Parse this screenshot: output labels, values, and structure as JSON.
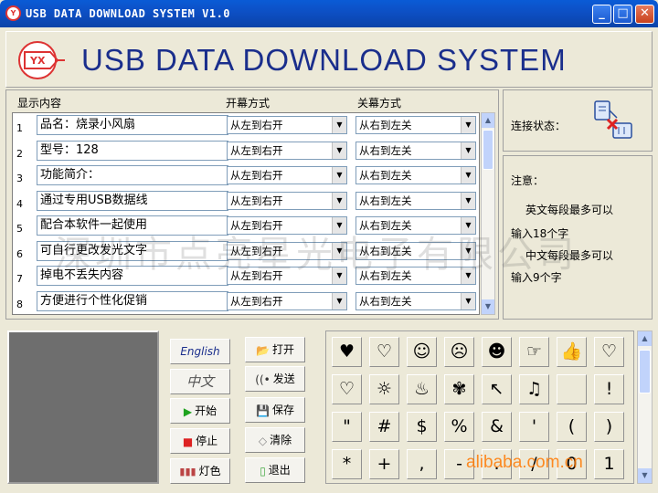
{
  "window": {
    "title": "USB DATA DOWNLOAD SYSTEM V1.0"
  },
  "header": {
    "logo_text": "YX",
    "app_title": "USB DATA DOWNLOAD SYSTEM"
  },
  "list": {
    "col_content": "显示内容",
    "col_open": "开幕方式",
    "col_close": "关幕方式",
    "rows": [
      {
        "num": "1",
        "text": "品名：烧录小风扇",
        "open": "从左到右开",
        "close": "从右到左关"
      },
      {
        "num": "2",
        "text": "型号：128",
        "open": "从左到右开",
        "close": "从右到左关"
      },
      {
        "num": "3",
        "text": "    功能简介：",
        "open": "从左到右开",
        "close": "从右到左关"
      },
      {
        "num": "4",
        "text": "通过专用USB数据线",
        "open": "从左到右开",
        "close": "从右到左关"
      },
      {
        "num": "5",
        "text": "配合本软件一起使用",
        "open": "从左到右开",
        "close": "从右到左关"
      },
      {
        "num": "6",
        "text": "可自行更改发光文字",
        "open": "从左到右开",
        "close": "从右到左关"
      },
      {
        "num": "7",
        "text": "掉电不丢失内容",
        "open": "从左到右开",
        "close": "从右到左关"
      },
      {
        "num": "8",
        "text": "方便进行个性化促销",
        "open": "从左到右开",
        "close": "从右到左关"
      }
    ]
  },
  "status": {
    "label": "连接状态："
  },
  "notes": {
    "title": "注意：",
    "line1": "英文每段最多可以",
    "line2": "输入18个字",
    "line3": "中文每段最多可以",
    "line4": "输入9个字"
  },
  "controls": {
    "english": "English",
    "chinese": "中文",
    "start": "开始",
    "stop": "停止",
    "lights": "灯色",
    "open": "打开",
    "send": "发送",
    "save": "保存",
    "clear": "清除",
    "exit": "退出"
  },
  "symbols": {
    "row3": [
      "\"",
      "#",
      "$",
      "%",
      "&",
      "'",
      "(",
      ")"
    ],
    "row4": [
      "*",
      "+",
      ",",
      "-",
      ".",
      "/",
      "0",
      "1"
    ],
    "row2_last": "!"
  },
  "watermarks": {
    "cn": "深圳市点亮星光电子有限公司",
    "alibaba": "alibaba.com.cn"
  },
  "colors": {
    "title_bar": "#0B4FC6",
    "app_title": "#1A2E8C",
    "accent_red": "#D33333"
  }
}
